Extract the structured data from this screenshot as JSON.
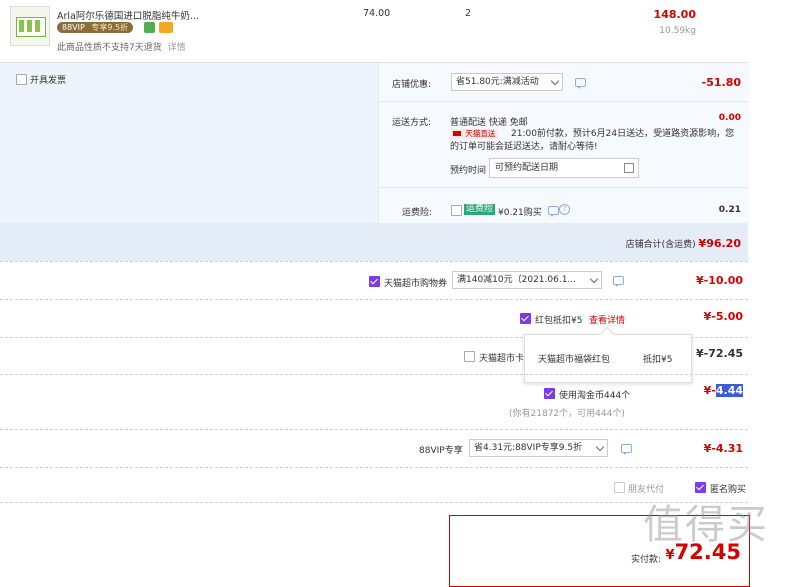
{
  "product": {
    "title": "Arla阿尔乐德国进口脱脂纯牛奶...",
    "vip_tag": "88VIP",
    "vip_discount": "专享9.5折",
    "return_note": "此商品性质不支持7天退货",
    "return_detail": "详情",
    "unit_price": "74.00",
    "quantity": "2",
    "subtotal": "148.00",
    "weight": "10.59kg"
  },
  "invoice": {
    "label": "开具发票"
  },
  "shop_discount": {
    "label": "店铺优惠:",
    "selected": "省51.80元:满减活动",
    "amount": "-51.80"
  },
  "shipping": {
    "label": "运送方式:",
    "method": "普通配送 快递 免邮",
    "fee": "0.00",
    "badge": "天猫直送",
    "notice": "21:00前付款，预计6月24日送达，受道路资源影响，您的订单可能会延迟送达，请耐心等待!",
    "schedule_label": "预约时间",
    "schedule_placeholder": "可预约配送日期"
  },
  "insurance": {
    "label": "运费险:",
    "badge": "运费险",
    "price": "¥0.21购买",
    "amount": "0.21"
  },
  "shop_total": {
    "label": "店铺合计(含运费)",
    "value": "¥96.20"
  },
  "coupon": {
    "label": "天猫超市购物券",
    "selected": "满140减10元（2021.06.1...",
    "amount": "¥-10.00"
  },
  "red_packet": {
    "label": "红包抵扣¥5",
    "link": "查看详情",
    "amount": "¥-5.00"
  },
  "popup": {
    "name": "天猫超市福袋红包",
    "value": "抵扣¥5"
  },
  "tmall_card": {
    "label": "天猫超市卡",
    "amount": "¥-72.45"
  },
  "taojinbi": {
    "label": "使用淘金币444个",
    "note": "(你有21872个，可用444个)",
    "amount_prefix": "¥-",
    "amount_value": "4.44"
  },
  "vip88": {
    "label": "88VIP专享",
    "selected": "省4.31元:88VIP专享9.5折",
    "amount": "¥-4.31"
  },
  "pay_options": {
    "friend_pay": "朋友代付",
    "anonymous": "匿名购买"
  },
  "actual_pay": {
    "label": "实付款:",
    "currency": "¥",
    "value": "72.45"
  },
  "watermark": "值得买",
  "colors": {
    "accent_red": "#d40000",
    "check_purple": "#7a3ce6",
    "panel_bg": "#eef4fb"
  }
}
